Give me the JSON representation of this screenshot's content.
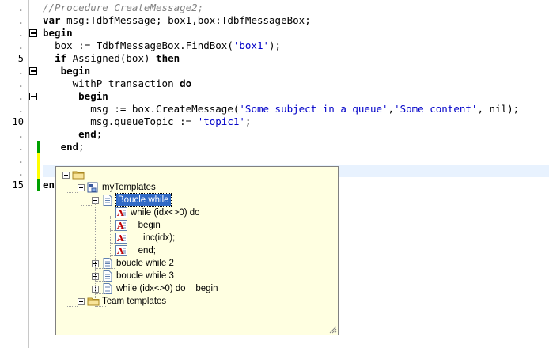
{
  "editor": {
    "line_numbers": [
      ".",
      ".",
      ".",
      ".",
      "5",
      ".",
      ".",
      ".",
      ".",
      "10",
      ".",
      ".",
      ".",
      ".",
      "15"
    ],
    "lines": [
      {
        "text": "//Procedure CreateMessage2;"
      },
      {
        "text": "var msg:TdbfMessage; box1,box:TdbfMessageBox;"
      },
      {
        "text": "begin"
      },
      {
        "text": "  box := TdbfMessageBox.FindBox('box1');"
      },
      {
        "text": "  if Assigned(box) then"
      },
      {
        "text": "   begin"
      },
      {
        "text": "     withP transaction do"
      },
      {
        "text": "      begin"
      },
      {
        "text": "        msg := box.CreateMessage('Some subject in a queue','Some content', nil);"
      },
      {
        "text": "        msg.queueTopic := 'topic1';"
      },
      {
        "text": "      end;"
      },
      {
        "text": "   end;"
      },
      {
        "text": ""
      },
      {
        "text": ""
      },
      {
        "text": "en"
      }
    ]
  },
  "popup": {
    "tree": [
      {
        "label": "",
        "icon": "folder-icon",
        "level": 0,
        "expander": "minus"
      },
      {
        "label": "myTemplates",
        "icon": "template-group-icon",
        "level": 1,
        "expander": "minus"
      },
      {
        "label": "Boucle while",
        "icon": "document-icon",
        "level": 2,
        "expander": "minus",
        "selected": true
      },
      {
        "label": "while (idx<>0) do",
        "icon": "text-a-icon",
        "level": 3
      },
      {
        "label": "   begin",
        "icon": "text-a-icon",
        "level": 3
      },
      {
        "label": "     inc(idx);",
        "icon": "text-a-icon",
        "level": 3
      },
      {
        "label": "   end;",
        "icon": "text-a-icon",
        "level": 3
      },
      {
        "label": "boucle while 2",
        "icon": "document-icon",
        "level": 2,
        "expander": "plus"
      },
      {
        "label": "boucle while 3",
        "icon": "document-icon",
        "level": 2,
        "expander": "plus"
      },
      {
        "label": "while (idx<>0) do    begin",
        "icon": "document-icon",
        "level": 2,
        "expander": "plus"
      },
      {
        "label": "Team templates",
        "icon": "folder-icon",
        "level": 1,
        "expander": "plus"
      }
    ]
  },
  "colors": {
    "comment": "#808080",
    "string": "#0000c8",
    "current_line": "#e8f2fe",
    "popup_bg": "#ffffe1",
    "selection": "#316ac5",
    "modified_marker": "#00a000",
    "unsaved_marker": "#ffff00"
  }
}
